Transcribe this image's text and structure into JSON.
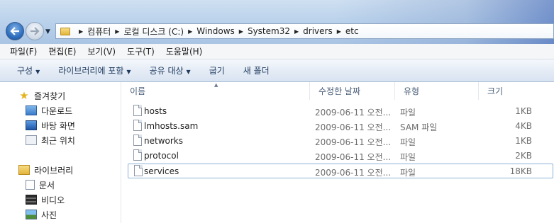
{
  "address": {
    "crumbs": [
      "컴퓨터",
      "로컬 디스크 (C:)",
      "Windows",
      "System32",
      "drivers",
      "etc"
    ]
  },
  "menu": [
    "파일(F)",
    "편집(E)",
    "보기(V)",
    "도구(T)",
    "도움말(H)"
  ],
  "commands": [
    {
      "label": "구성",
      "has_caret": true
    },
    {
      "label": "라이브러리에 포함",
      "has_caret": true
    },
    {
      "label": "공유 대상",
      "has_caret": true
    },
    {
      "label": "굽기",
      "has_caret": false
    },
    {
      "label": "새 폴더",
      "has_caret": false
    }
  ],
  "nav": {
    "favorites_label": "즐겨찾기",
    "favorites": [
      {
        "label": "다운로드",
        "icon": "download-folder-icon"
      },
      {
        "label": "바탕 화면",
        "icon": "desktop-icon"
      },
      {
        "label": "최근 위치",
        "icon": "recent-places-icon"
      }
    ],
    "libraries_label": "라이브러리",
    "libraries": [
      {
        "label": "문서",
        "icon": "documents-icon"
      },
      {
        "label": "비디오",
        "icon": "videos-icon"
      },
      {
        "label": "사진",
        "icon": "pictures-icon"
      }
    ]
  },
  "columns": {
    "name": "이름",
    "modified": "수정한 날짜",
    "type": "유형",
    "size": "크기"
  },
  "files": [
    {
      "name": "hosts",
      "modified": "2009-06-11 오전...",
      "type": "파일",
      "size": "1KB"
    },
    {
      "name": "lmhosts.sam",
      "modified": "2009-06-11 오전...",
      "type": "SAM 파일",
      "size": "4KB"
    },
    {
      "name": "networks",
      "modified": "2009-06-11 오전...",
      "type": "파일",
      "size": "1KB"
    },
    {
      "name": "protocol",
      "modified": "2009-06-11 오전...",
      "type": "파일",
      "size": "2KB"
    },
    {
      "name": "services",
      "modified": "2009-06-11 오전...",
      "type": "파일",
      "size": "18KB"
    }
  ],
  "focused_file": "services"
}
